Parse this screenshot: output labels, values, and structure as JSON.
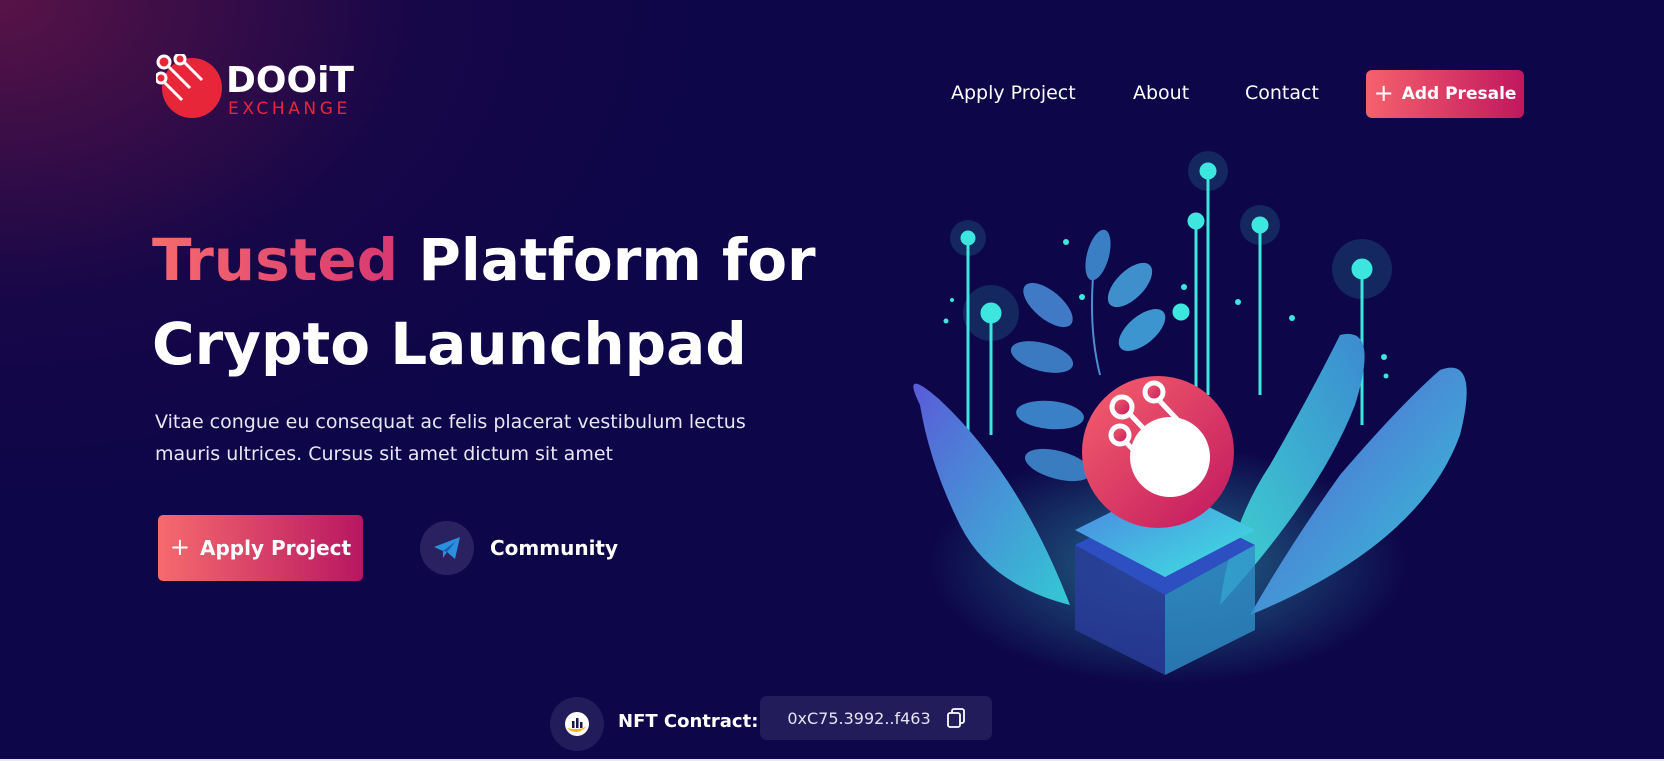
{
  "header": {
    "logo": {
      "name": "DOOiT",
      "sub": "EXCHANGE"
    },
    "nav": [
      "Apply Project",
      "About",
      "Contact"
    ],
    "cta": "Add Presale"
  },
  "hero": {
    "title_accent": "Trusted",
    "title_rest": "Platform for",
    "title_line2": "Crypto Launchpad",
    "description": "Vitae congue eu consequat ac felis placerat vestibulum lectus mauris ultrices. Cursus sit amet dictum sit amet",
    "primary_button": "Apply Project",
    "community_label": "Community"
  },
  "contract": {
    "label": "NFT Contract:",
    "address": "0xC75.3992..f463"
  },
  "icons": {
    "presale": "plus-icon",
    "apply": "plus-icon",
    "community": "telegram-icon",
    "contract": "coin-chart-icon",
    "copy": "copy-icon"
  },
  "colors": {
    "background": "#0d0648",
    "accent_start": "#f66a6e",
    "accent_end": "#b81761",
    "logo_red": "#e8263a",
    "teal": "#3ee6e0"
  }
}
